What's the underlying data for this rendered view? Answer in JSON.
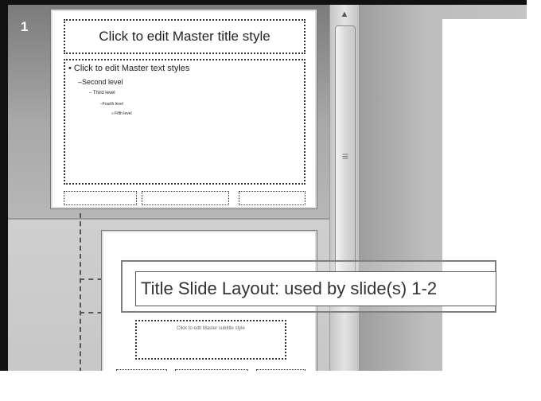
{
  "thumbnail_pane": {
    "selected_slide_number": "1",
    "master_slide": {
      "title": "Click to edit Master title style",
      "text_levels": [
        "• Click to edit Master text styles",
        "–Second level",
        "– Third level",
        "–Fourth level",
        "» Fifth level"
      ]
    },
    "layout_slide": {
      "subtitle_placeholder": "Click to edit Master subtitle style"
    }
  },
  "tooltip": {
    "text": "Title Slide Layout: used by slide(s) 1-2"
  },
  "colors": {
    "pane_selected": "#8c8c8c",
    "pane_background": "#c7c7c7",
    "tooltip_border": "#7f7f7f"
  }
}
